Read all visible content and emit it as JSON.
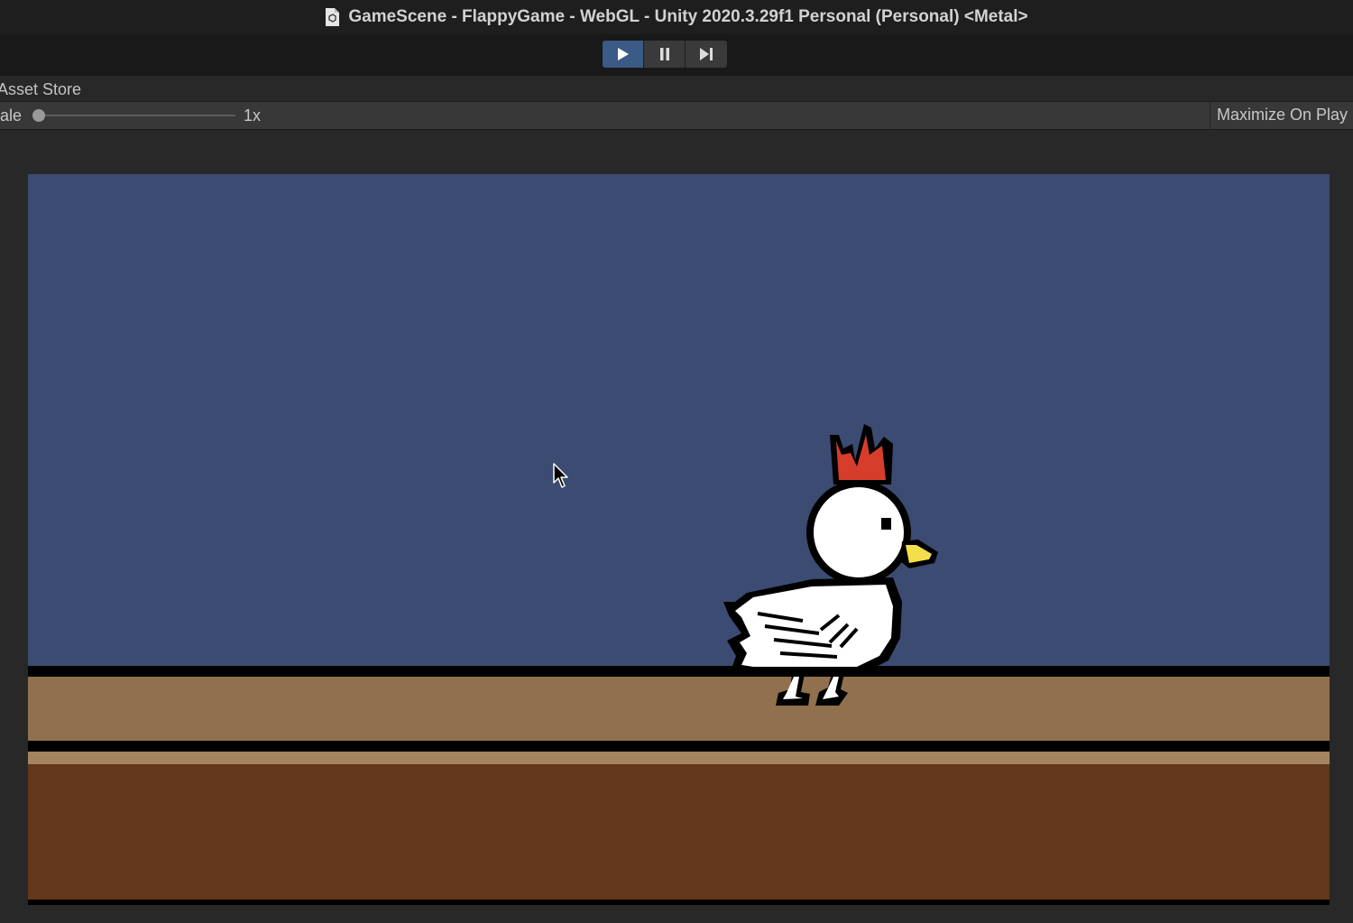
{
  "window": {
    "title": "GameScene - FlappyGame - WebGL - Unity 2020.3.29f1 Personal (Personal) <Metal>",
    "icon": "unity-document-icon"
  },
  "toolbar": {
    "play_icon": "play-icon",
    "pause_icon": "pause-icon",
    "step_icon": "step-icon"
  },
  "tab": {
    "label": "Asset Store"
  },
  "game_options": {
    "scale_label": "ale",
    "scale_value": "1x",
    "maximize_label": "Maximize On Play"
  },
  "colors": {
    "sky": "#3b4b71",
    "ground_top": "#91704d",
    "ground_bottom": "#64381c",
    "play_active": "#3b5a86"
  }
}
